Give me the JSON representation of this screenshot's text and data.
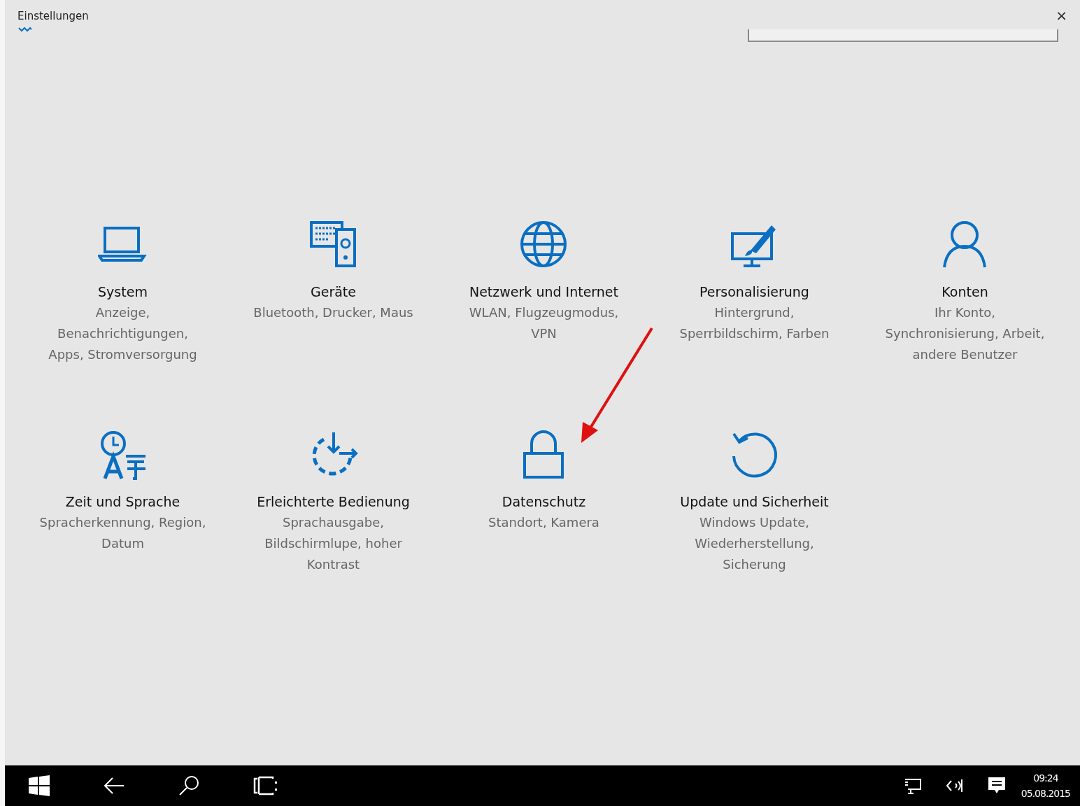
{
  "window": {
    "title": "Einstellungen",
    "close": "×"
  },
  "search": {
    "kind": "field"
  },
  "tiles": [
    {
      "title": "System",
      "description": "Anzeige, Benachrichtigungen, Apps, Stromversorgung"
    },
    {
      "title": "Geräte",
      "description": "Bluetooth, Drucker, Maus"
    },
    {
      "title": "Netzwerk und Internet",
      "description": "WLAN, Flugzeugmodus, VPN"
    },
    {
      "title": "Personalisierung",
      "description": "Hintergrund, Sperrbildschirm, Farben"
    },
    {
      "title": "Konten",
      "description": "Ihr Konto, Synchronisierung, Arbeit, andere Benutzer"
    },
    {
      "title": "Zeit und Sprache",
      "description": "Spracherkennung, Region, Datum"
    },
    {
      "title": "Erleichterte Bedienung",
      "description": "Sprachausgabe, Bildschirmlupe, hoher Kontrast"
    },
    {
      "title": "Datenschutz",
      "description": "Standort, Kamera"
    },
    {
      "title": "Update und Sicherheit",
      "description": "Windows Update, Wiederherstellung, Sicherung"
    }
  ],
  "taskbar": {
    "time": "09:24",
    "date": "05.08.2015"
  }
}
